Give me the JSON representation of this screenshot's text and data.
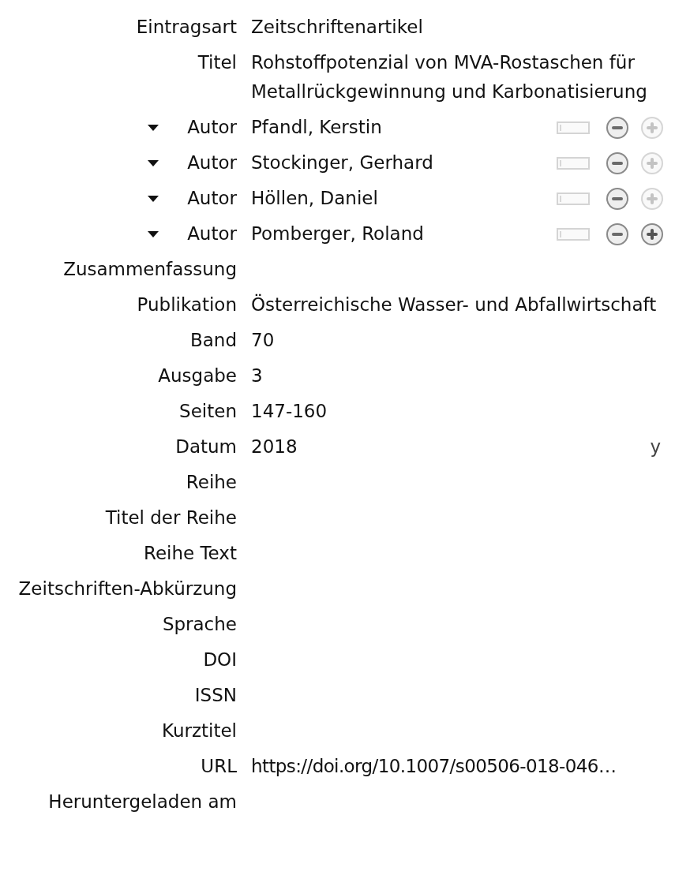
{
  "fields": [
    {
      "kind": "text",
      "label": "Eintragsart",
      "value": "Zeitschriftenartikel"
    },
    {
      "kind": "text",
      "label": "Titel",
      "value": "Rohstoffpotenzial von MVA-Rostaschen für Metallrückgewinnung und Karbonatisierung"
    },
    {
      "kind": "creator",
      "label": "Autor",
      "value": "Pfandl, Kerstin",
      "add_enabled": false
    },
    {
      "kind": "creator",
      "label": "Autor",
      "value": "Stockinger, Gerhard",
      "add_enabled": false
    },
    {
      "kind": "creator",
      "label": "Autor",
      "value": "Höllen, Daniel",
      "add_enabled": false
    },
    {
      "kind": "creator",
      "label": "Autor",
      "value": "Pomberger, Roland",
      "add_enabled": true
    },
    {
      "kind": "text",
      "label": "Zusammenfassung"
    },
    {
      "kind": "text",
      "label": "Publikation",
      "value": "Österreichische Wasser- und Abfallwirtschaft"
    },
    {
      "kind": "text",
      "label": "Band",
      "value": "70"
    },
    {
      "kind": "text",
      "label": "Ausgabe",
      "value": "3"
    },
    {
      "kind": "text",
      "label": "Seiten",
      "value": "147-160"
    },
    {
      "kind": "date",
      "label": "Datum",
      "value": "2018",
      "suffix": "y"
    },
    {
      "kind": "text",
      "label": "Reihe"
    },
    {
      "kind": "text",
      "label": "Titel der Reihe"
    },
    {
      "kind": "text",
      "label": "Reihe Text"
    },
    {
      "kind": "text",
      "label": "Zeitschriften-Abkürzung"
    },
    {
      "kind": "text",
      "label": "Sprache"
    },
    {
      "kind": "text",
      "label": "DOI"
    },
    {
      "kind": "text",
      "label": "ISSN"
    },
    {
      "kind": "text",
      "label": "Kurztitel"
    },
    {
      "kind": "url",
      "label": "URL",
      "value": "https://doi.org/10.1007/s00506-018-046…"
    },
    {
      "kind": "text",
      "label": "Heruntergeladen am"
    }
  ]
}
